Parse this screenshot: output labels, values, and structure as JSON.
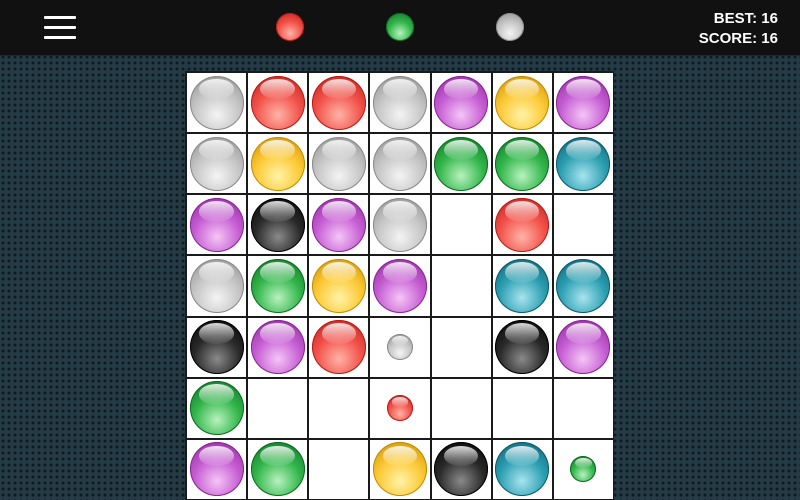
{
  "header": {
    "menu_icon": "hamburger-menu-icon",
    "next_balls": [
      "red",
      "green",
      "gray"
    ],
    "best_label": "BEST: 16",
    "score_label": "SCORE: 16"
  },
  "colors": {
    "gray": {
      "light": "#f4f4f4",
      "mid": "#c6c6c6",
      "dark": "#8a8a8a"
    },
    "red": {
      "light": "#ffb3a8",
      "mid": "#f2524a",
      "dark": "#b81c16"
    },
    "purple": {
      "light": "#f4c6f6",
      "mid": "#c65ed3",
      "dark": "#8a2596"
    },
    "yellow": {
      "light": "#fff3a8",
      "mid": "#fcc936",
      "dark": "#c48c00"
    },
    "green": {
      "light": "#b8f2be",
      "mid": "#31b54a",
      "dark": "#0d6d23"
    },
    "teal": {
      "light": "#a8e4ef",
      "mid": "#2b9fb1",
      "dark": "#0d5b6c"
    },
    "black": {
      "light": "#8a8a8a",
      "mid": "#2a2a2a",
      "dark": "#000000"
    }
  },
  "board": {
    "rows": [
      [
        "gray",
        "red",
        "red",
        "gray",
        "purple",
        "yellow",
        "purple"
      ],
      [
        "gray",
        "yellow",
        "gray",
        "gray",
        "green",
        "green",
        "teal"
      ],
      [
        "purple",
        "black",
        "purple",
        "gray",
        "",
        "red",
        ""
      ],
      [
        "gray",
        "green",
        "yellow",
        "purple",
        "",
        "teal",
        "teal"
      ],
      [
        "black",
        "purple",
        "red",
        "gray-small",
        "",
        "black",
        "purple"
      ],
      [
        "green",
        "",
        "",
        "red-small",
        "",
        "",
        ""
      ],
      [
        "purple",
        "green",
        "",
        "yellow",
        "black",
        "teal",
        "green-small"
      ]
    ]
  }
}
